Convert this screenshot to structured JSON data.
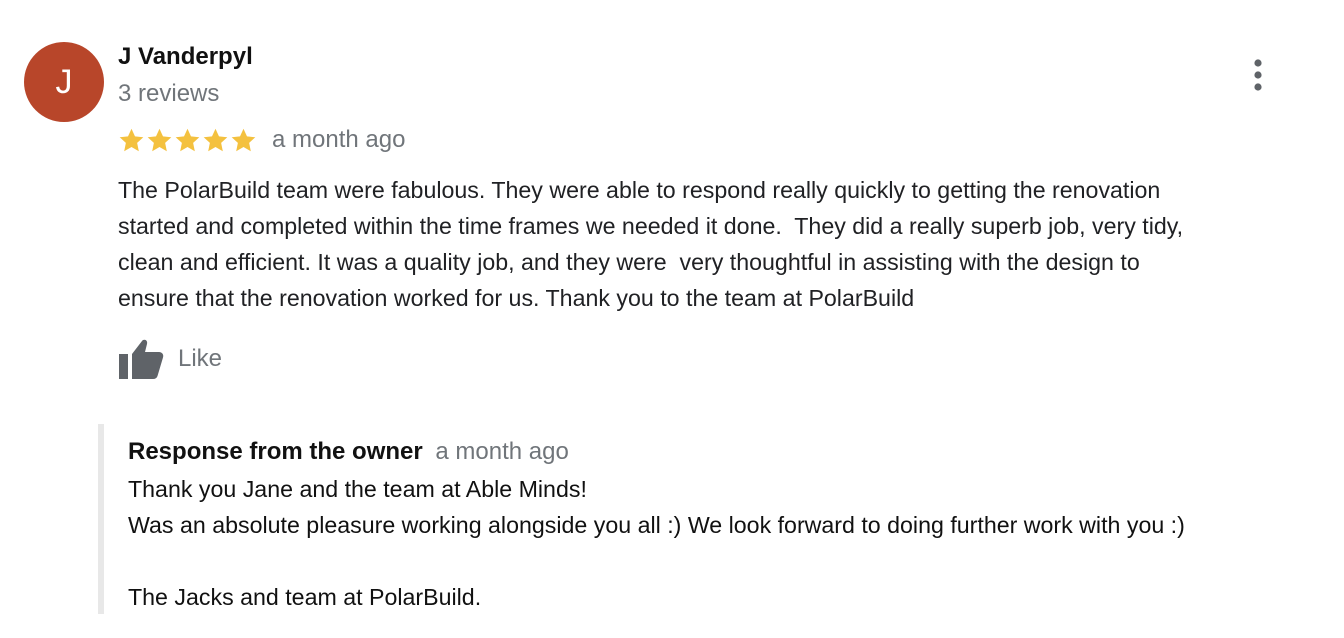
{
  "colors": {
    "avatar_bg": "#b8462a",
    "star": "#f4c13f",
    "secondary_text": "#70757a",
    "icon_gray": "#5f6368"
  },
  "review": {
    "avatar_initial": "J",
    "reviewer_name": "J Vanderpyl",
    "review_count": "3 reviews",
    "rating": 5,
    "rating_max": 5,
    "date": "a month ago",
    "text": "The PolarBuild team were fabulous. They were able to respond really quickly to getting the renovation\nstarted and completed within the time frames we needed it done.  They did a really superb job, very tidy,\nclean and efficient. It was a quality job, and they were  very thoughtful in assisting with the design to\nensure that the renovation worked for us. Thank you to the team at PolarBuild",
    "more_icon": "more-vert-icon",
    "like_icon": "thumbs-up-icon",
    "like_label": "Like"
  },
  "owner_response": {
    "title": "Response from the owner",
    "date": "a month ago",
    "text": "Thank you Jane and the team at Able Minds!\nWas an absolute pleasure working alongside you all :) We look forward to doing further work with you :)\n\nThe Jacks and team at PolarBuild."
  }
}
